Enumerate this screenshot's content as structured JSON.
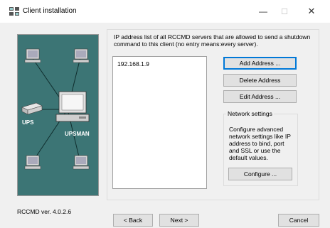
{
  "window": {
    "title": "Client installation",
    "minimize_glyph": "—",
    "maximize_glyph": "☐",
    "close_glyph": "✕"
  },
  "graphic": {
    "ups_label": "UPS",
    "upsman_label": "UPSMAN"
  },
  "servers": {
    "description": "IP address list of all RCCMD servers that are allowed to send a shutdown command to this client (no entry means:every server).",
    "list_items": [
      "192.168.1.9"
    ],
    "add_label": "Add Address ...",
    "delete_label": "Delete Address",
    "edit_label": "Edit Address ..."
  },
  "network": {
    "legend": "Network settings",
    "description": "Configure advanced network settings like IP address to bind, port and SSL or use the default values.",
    "configure_label": "Configure ..."
  },
  "footer": {
    "version": "RCCMD ver. 4.0.2.6",
    "back_label": "< Back",
    "next_label": "Next >",
    "cancel_label": "Cancel"
  },
  "colors": {
    "panel_background": "#3c7575",
    "accent": "#0078d7"
  }
}
